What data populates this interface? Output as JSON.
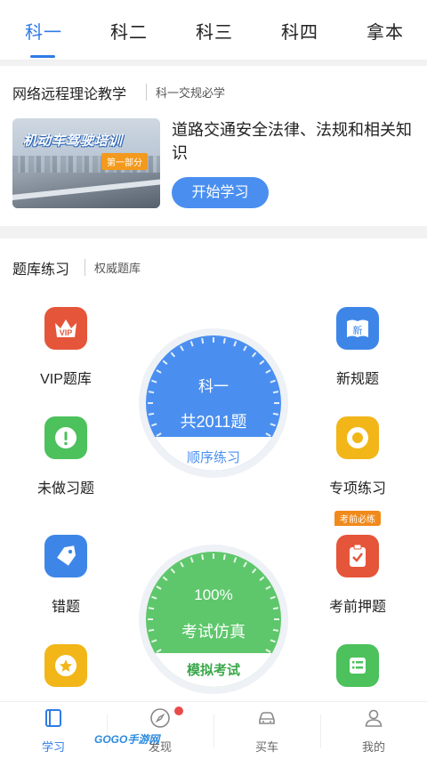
{
  "tabs": [
    {
      "label": "科一",
      "active": true
    },
    {
      "label": "科二"
    },
    {
      "label": "科三"
    },
    {
      "label": "科四"
    },
    {
      "label": "拿本"
    }
  ],
  "course": {
    "section_title": "网络远程理论教学",
    "section_sub": "科一交规必学",
    "thumb_title": "机动车驾驶培训",
    "thumb_badge": "第一部分",
    "title": "道路交通安全法律、法规和相关知识",
    "button": "开始学习"
  },
  "practice": {
    "section_title": "题库练习",
    "section_sub": "权威题库",
    "items": {
      "vip": {
        "label": "VIP题库",
        "icon": "vip-crown-icon",
        "color": "#e5553a"
      },
      "new_rules": {
        "label": "新规题",
        "icon": "new-book-icon",
        "color": "#3d86e8"
      },
      "undone": {
        "label": "未做习题",
        "icon": "exclamation-icon",
        "color": "#4cc15c"
      },
      "special": {
        "label": "专项练习",
        "icon": "target-icon",
        "color": "#f2b619"
      },
      "wrong": {
        "label": "错题",
        "icon": "tag-icon",
        "color": "#3d86e8"
      },
      "pre_exam": {
        "label": "考前押题",
        "icon": "clipboard-check-icon",
        "color": "#e5553a",
        "tag": "考前必练"
      },
      "favorite": {
        "icon": "star-icon",
        "color": "#f2b619"
      },
      "list": {
        "icon": "list-icon",
        "color": "#4cc15c"
      }
    },
    "dial_order": {
      "subject": "科一",
      "count": "共2011题",
      "label": "顺序练习",
      "color": "#4a8ff0"
    },
    "dial_exam": {
      "percent": "100%",
      "title": "考试仿真",
      "label": "模拟考试",
      "color": "#5ec76b"
    }
  },
  "nav": [
    {
      "label": "学习",
      "icon": "book-icon",
      "active": true
    },
    {
      "label": "发现",
      "icon": "compass-icon",
      "badge": true
    },
    {
      "label": "买车",
      "icon": "car-icon"
    },
    {
      "label": "我的",
      "icon": "user-icon"
    }
  ],
  "watermark": "GOGO手游网"
}
